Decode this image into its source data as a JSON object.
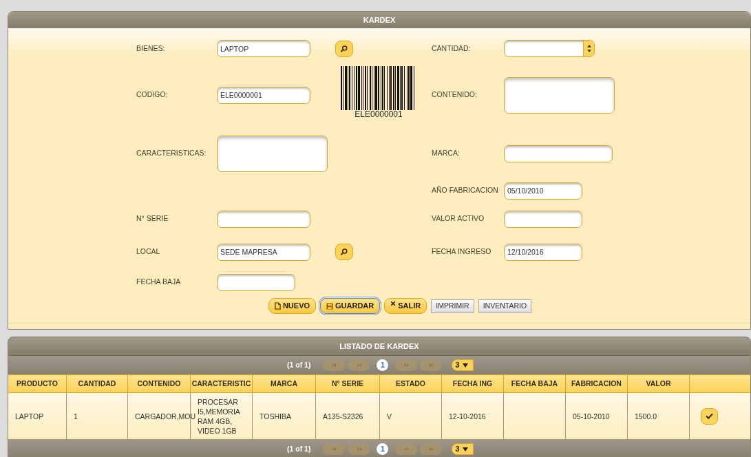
{
  "form_panel": {
    "title": "KARDEX"
  },
  "form_rows": [
    {
      "left": {
        "label": "BIENES:",
        "value": "LAPTOP",
        "kind": "text",
        "lookup": true
      },
      "right": {
        "label": "CANTIDAD:",
        "kind": "spinner"
      }
    },
    {
      "left": {
        "label": "CODIGO:",
        "value": "ELE0000001",
        "kind": "text"
      },
      "barcode": "ELE0000001",
      "right": {
        "label": "CONTENIDO:",
        "kind": "textarea"
      }
    },
    {
      "left": {
        "label": "CARACTERISTICAS:",
        "kind": "textarea"
      },
      "right": {
        "label": "MARCA:",
        "kind": "text"
      }
    },
    {
      "right": {
        "label": "AÑO FABRICACION",
        "value": "05/10/2010",
        "kind": "date"
      }
    },
    {
      "left": {
        "label": "N° SERIE",
        "kind": "text"
      },
      "right": {
        "label": "VALOR ACTIVO",
        "kind": "date"
      }
    },
    {
      "left": {
        "label": "LOCAL",
        "value": "SEDE MAPRESA",
        "kind": "text",
        "lookup": true
      },
      "right": {
        "label": "FECHA INGRESO",
        "value": "12/10/2016",
        "kind": "date"
      }
    },
    {
      "left": {
        "label": "FECHA BAJA",
        "kind": "date"
      }
    }
  ],
  "buttons": [
    {
      "label": "NUEVO",
      "kind": "new",
      "focused": false
    },
    {
      "label": "GUARDAR",
      "kind": "save",
      "focused": true
    },
    {
      "label": "SALIR",
      "kind": "exit",
      "focused": false
    },
    {
      "label": "IMPRIMIR",
      "kind": "plain",
      "focused": false
    },
    {
      "label": "INVENTARIO",
      "kind": "plain",
      "focused": false
    }
  ],
  "list_panel": {
    "title": "LISTADO DE KARDEX"
  },
  "paginator_top": {
    "summary": "(1 of 1)",
    "pages": [
      {
        "label": "1",
        "selected": true
      }
    ],
    "rows_per_page": "3"
  },
  "table": {
    "columns": [
      "PRODUCTO",
      "CANTIDAD",
      "CONTENIDO",
      "CARACTERISTIC",
      "MARCA",
      "N° SERIE",
      "ESTADO",
      "FECHA ING",
      "FECHA BAJA",
      "FABRICACION",
      "VALOR"
    ],
    "rows": [
      {
        "cells": [
          "LAPTOP",
          "1",
          "CARGADOR,MOU",
          "PROCESAR I5,MEMORIA RAM 4GB, VIDEO 1GB",
          "TOSHIBA",
          "A135-S2326",
          "V",
          "12-10-2016",
          "",
          "05-10-2010",
          "1500.0"
        ]
      }
    ]
  },
  "paginator_bottom": {
    "summary": "(1 of 1)",
    "pages": [
      {
        "label": "1",
        "selected": true
      }
    ],
    "rows_per_page": "3"
  }
}
